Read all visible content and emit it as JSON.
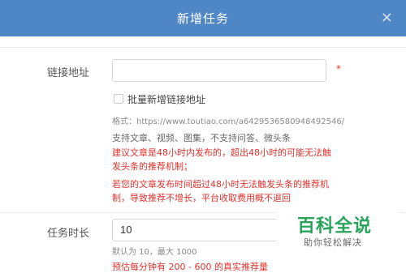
{
  "dialog": {
    "title": "新增任务",
    "close_label": "×"
  },
  "link_field": {
    "label": "链接地址",
    "value": "",
    "placeholder": "",
    "required_mark": "*"
  },
  "batch_add": {
    "label": "批量新增链接地址",
    "checked": false
  },
  "hints": {
    "format": "格式：https://www.toutiao.com/a6429536580948492546/",
    "support": "支持文章、视频、图集，不支持问答、微头条",
    "warning1": "建议文章是48小时内发布的，超出48小时的可能无法触发头条的推荐机制；",
    "warning2": "若您的文章发布时间超过48小时无法触发头条的推荐机制，导致推荐不增长，平台收取费用概不退回"
  },
  "duration_field": {
    "label": "任务时长",
    "value": "10",
    "default_hint": "默认为 10，最大 1000",
    "estimate": "预估每分钟有 200 - 600 的真实推荐量"
  },
  "watermark": {
    "title": "百科全说",
    "subtitle": "助你轻松解决"
  },
  "colors": {
    "header": "#4f86c6",
    "warning": "#e2322d",
    "watermark": "#27a35a"
  }
}
